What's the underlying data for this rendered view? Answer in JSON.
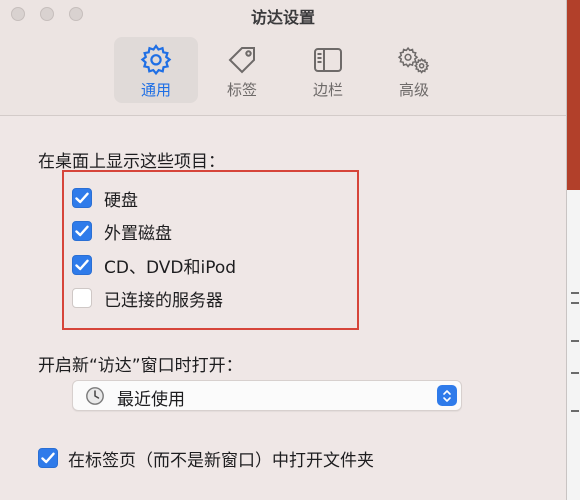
{
  "window": {
    "title": "访达设置"
  },
  "toolbar": {
    "tabs": [
      {
        "label": "通用",
        "icon": "gear-icon",
        "active": true
      },
      {
        "label": "标签",
        "icon": "tag-icon",
        "active": false
      },
      {
        "label": "边栏",
        "icon": "sidebar-icon",
        "active": false
      },
      {
        "label": "高级",
        "icon": "gears-icon",
        "active": false
      }
    ]
  },
  "desktop_items": {
    "label": "在桌面上显示这些项目：",
    "items": [
      {
        "label": "硬盘",
        "checked": true
      },
      {
        "label": "外置磁盘",
        "checked": true
      },
      {
        "label": "CD、DVD和iPod",
        "checked": true
      },
      {
        "label": "已连接的服务器",
        "checked": false
      }
    ]
  },
  "new_window": {
    "label": "开启新“访达”窗口时打开：",
    "selected": "最近使用",
    "icon": "clock-icon"
  },
  "tabs_option": {
    "label": "在标签页（而不是新窗口）中打开文件夹",
    "checked": true
  },
  "colors": {
    "accent": "#2f7bea",
    "highlight_border": "#d6453a",
    "window_bg": "#efe7e6"
  }
}
